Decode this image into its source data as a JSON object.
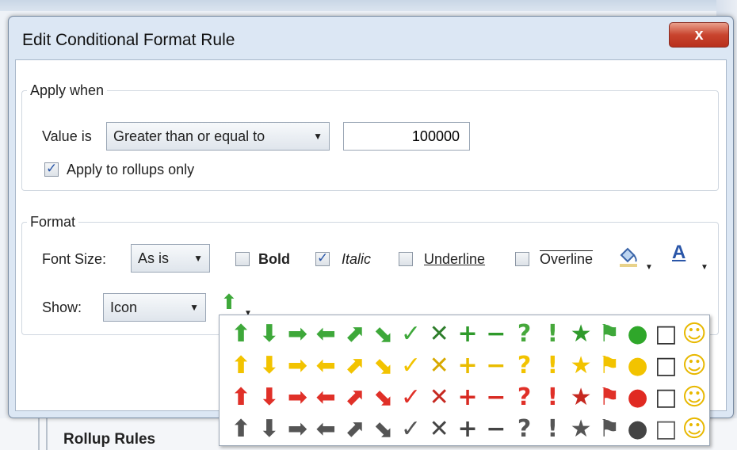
{
  "dialog": {
    "title": "Edit Conditional Format Rule",
    "close_glyph": "x"
  },
  "apply_when": {
    "legend": "Apply when",
    "value_is_label": "Value is",
    "operator": "Greater than or equal to",
    "value": "100000",
    "rollups_label": "Apply to rollups only",
    "rollups_checked": true
  },
  "format": {
    "legend": "Format",
    "font_size_label": "Font Size:",
    "font_size_value": "As is",
    "bold_label": "Bold",
    "bold_checked": false,
    "italic_label": "Italic",
    "italic_checked": true,
    "underline_label": "Underline",
    "underline_checked": false,
    "overline_label": "Overline",
    "overline_checked": false,
    "fill_icon": "paint-bucket-icon",
    "font_color_icon": "font-color-icon",
    "font_color_glyph": "A",
    "show_label": "Show:",
    "show_value": "Icon",
    "selected_icon": "green-up-arrow-icon"
  },
  "icon_picker": {
    "glyphs": [
      "⬆",
      "⬇",
      "➡",
      "⬅",
      "⬈",
      "⬊",
      "✓",
      "✕",
      "+",
      "−",
      "?",
      "!",
      "★",
      "⚑",
      "●",
      "□",
      "☺"
    ],
    "names": [
      "up-arrow",
      "down-arrow",
      "right-arrow",
      "left-arrow",
      "up-right-arrow",
      "down-right-arrow",
      "check",
      "cross",
      "plus",
      "minus",
      "question",
      "exclamation",
      "star",
      "flag",
      "circle",
      "gauge",
      "smiley"
    ],
    "rows": [
      {
        "color": "green",
        "colors": [
          "#3ea83a",
          "#3ea83a",
          "#3ea83a",
          "#3ea83a",
          "#3ea83a",
          "#3ea83a",
          "#3ea83a",
          "#2d7d2a",
          "#2f9a2b",
          "#2f9a2b",
          "#46a83b",
          "#46a83b",
          "#2f9a2b",
          "#3ea83a",
          "#2fa72a",
          "#333",
          "#e8b800"
        ]
      },
      {
        "color": "yellow",
        "colors": [
          "#f2c300",
          "#f2c300",
          "#f2c300",
          "#f2c300",
          "#f2c300",
          "#f2c300",
          "#f2c300",
          "#d8a900",
          "#e9bc00",
          "#e9bc00",
          "#f2c300",
          "#f2c300",
          "#f2c300",
          "#f2c300",
          "#f2c300",
          "#333",
          "#e8b800"
        ]
      },
      {
        "color": "red",
        "colors": [
          "#e03028",
          "#e03028",
          "#e03028",
          "#e03028",
          "#e03028",
          "#e03028",
          "#e03028",
          "#c62820",
          "#d82a22",
          "#d82a22",
          "#e03028",
          "#e03028",
          "#c62820",
          "#e03028",
          "#e02a22",
          "#333",
          "#e8b800"
        ]
      },
      {
        "color": "gray",
        "colors": [
          "#555",
          "#555",
          "#555",
          "#555",
          "#555",
          "#555",
          "#555",
          "#444",
          "#444",
          "#444",
          "#555",
          "#555",
          "#555",
          "#555",
          "#444",
          "#555",
          "#e8b800"
        ]
      }
    ]
  },
  "background": {
    "bottom_label": "Rollup Rules"
  }
}
